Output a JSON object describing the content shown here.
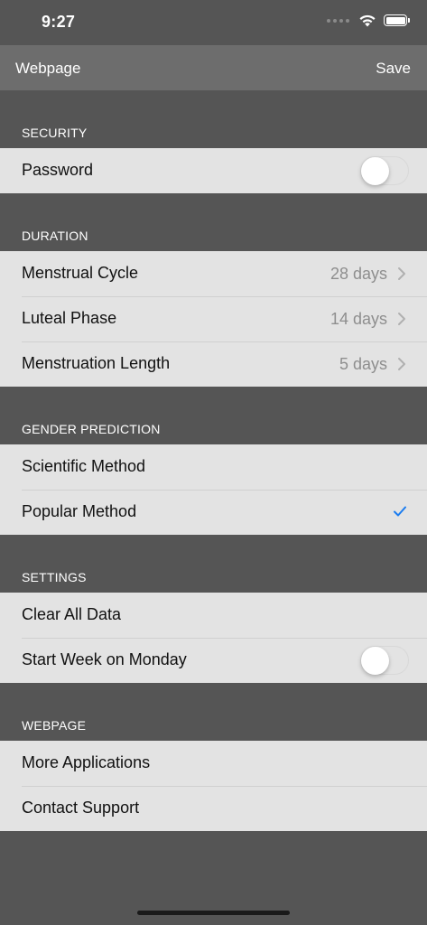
{
  "status_bar": {
    "time": "9:27",
    "icons": [
      "signal-dots-icon",
      "wifi-icon",
      "battery-icon"
    ]
  },
  "nav": {
    "title": "Webpage",
    "save_label": "Save"
  },
  "sections": {
    "security": {
      "header": "SECURITY",
      "password_label": "Password",
      "password_enabled": false
    },
    "duration": {
      "header": "DURATION",
      "menstrual_cycle_label": "Menstrual Cycle",
      "menstrual_cycle_value": "28 days",
      "luteal_phase_label": "Luteal Phase",
      "luteal_phase_value": "14 days",
      "menstruation_length_label": "Menstruation Length",
      "menstruation_length_value": "5 days"
    },
    "gender_prediction": {
      "header": "GENDER PREDICTION",
      "scientific_label": "Scientific Method",
      "popular_label": "Popular Method",
      "selected": "Popular Method"
    },
    "settings": {
      "header": "SETTINGS",
      "clear_label": "Clear All Data",
      "start_monday_label": "Start Week on Monday",
      "start_monday_enabled": false
    },
    "webpage": {
      "header": "WEBPAGE",
      "more_apps_label": "More Applications",
      "contact_label": "Contact Support"
    }
  },
  "colors": {
    "background": "#555555",
    "nav_bar": "#6d6d6d",
    "cell": "#e3e3e3",
    "accent_check": "#1a7cf0",
    "secondary_text": "#8e8e8e"
  }
}
